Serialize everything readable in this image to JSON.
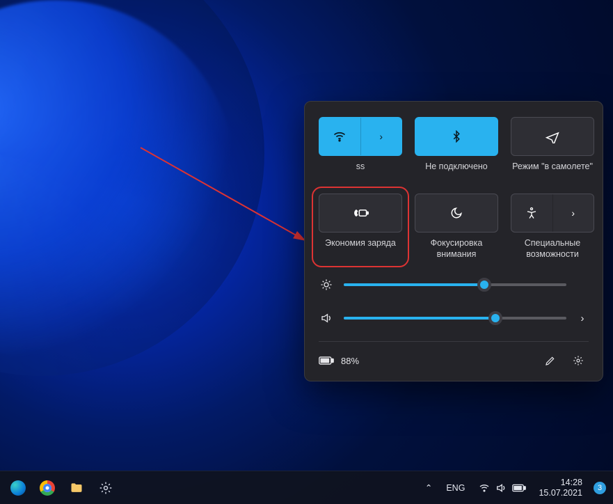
{
  "colors": {
    "accent": "#29b2ef",
    "highlight": "#d33"
  },
  "tiles": {
    "wifi": {
      "label": "ss",
      "active": true
    },
    "bluetooth": {
      "label": "Не подключено",
      "active": true
    },
    "airplane": {
      "label": "Режим \"в самолете\"",
      "active": false
    },
    "battery": {
      "label": "Экономия заряда",
      "active": false
    },
    "focus": {
      "label": "Фокусировка внимания",
      "active": false
    },
    "accessibility": {
      "label": "Специальные возможности",
      "active": false
    }
  },
  "sliders": {
    "brightness": {
      "value": 63
    },
    "volume": {
      "value": 68
    }
  },
  "footer": {
    "battery_text": "88%"
  },
  "taskbar": {
    "language": "ENG",
    "time": "14:28",
    "date": "15.07.2021",
    "notification_count": "3"
  }
}
